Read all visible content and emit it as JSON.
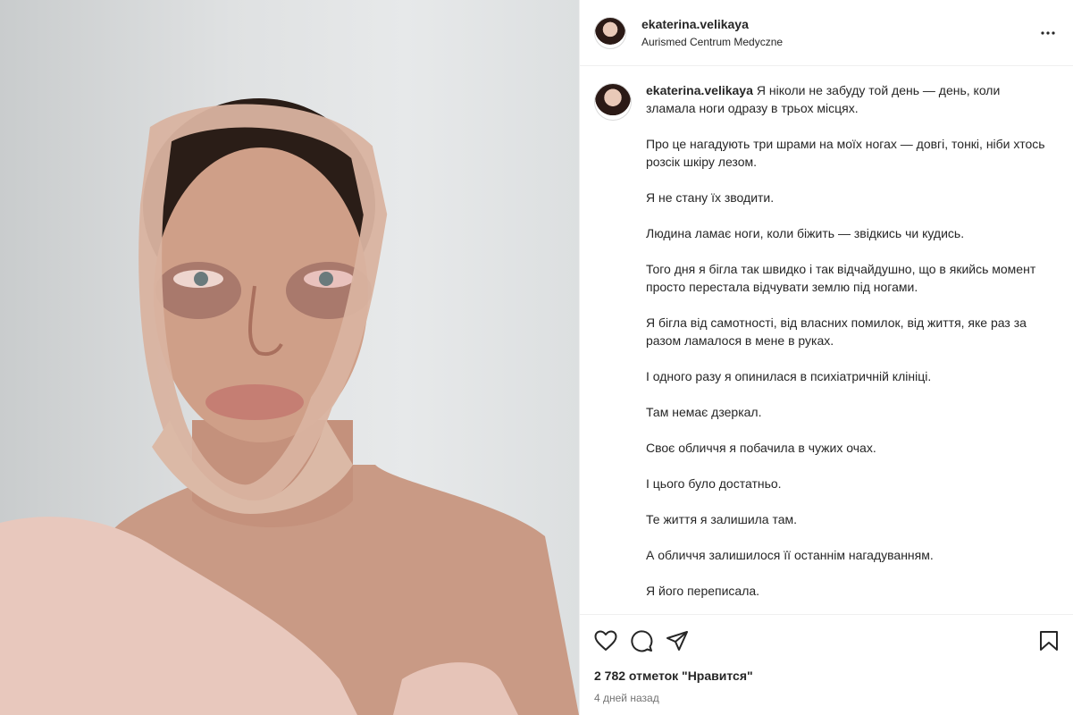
{
  "post": {
    "username": "ekaterina.velikaya",
    "location": "Aurismed Centrum Medyczne",
    "more_icon": "more-horizontal-icon",
    "caption_first": "Я ніколи не забуду той день — день, коли зламала ноги одразу в трьох місцях.",
    "caption_paragraphs": [
      "Про це нагадують три шрами на моїх ногах — довгі, тонкі, ніби хтось розсік шкіру лезом.",
      "Я не стану їх зводити.",
      "Людина ламає ноги, коли біжить — звідкись чи кудись.",
      "Того дня я бігла так швидко і так відчайдушно, що в якийсь момент просто перестала відчувати землю під ногами.",
      "Я бігла від самотності, від власних помилок, від життя, яке раз за разом ламалося в мене в руках.",
      "І одного разу я опинилася в психіатричній клініці.",
      "Там немає дзеркал.",
      "Своє обличчя я побачила в чужих очах.",
      "І цього було достатньо.",
      "Те життя я залишила там.",
      "А обличчя залишилося її останнім нагадуванням.",
      "Я його переписала."
    ],
    "likes": "2 782 отметок \"Нравится\"",
    "date": "4 дней назад"
  },
  "icons": {
    "like": "heart-icon",
    "comment": "comment-icon",
    "share": "send-icon",
    "save": "bookmark-icon"
  }
}
